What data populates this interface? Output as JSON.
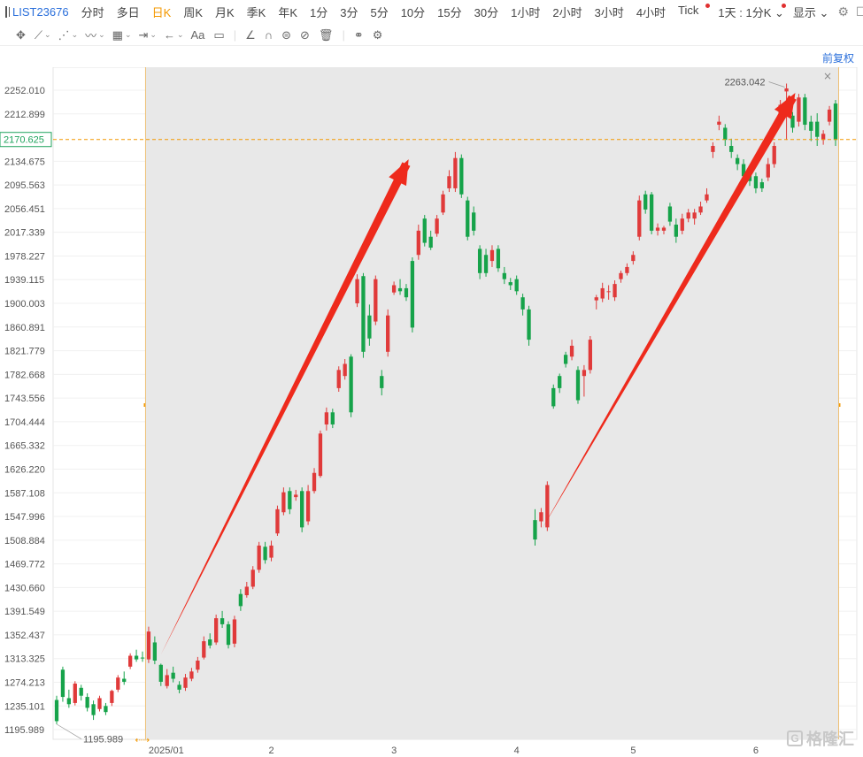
{
  "toolbar": {
    "symbol": "LIST23676",
    "periods": [
      "分时",
      "多日",
      "日K",
      "周K",
      "月K",
      "季K",
      "年K",
      "1分",
      "3分",
      "5分",
      "10分",
      "15分",
      "30分",
      "1小时",
      "2小时",
      "3小时",
      "4小时",
      "Tick"
    ],
    "active_period": "日K",
    "multi_period": "1天 : 1分K",
    "display": "显示"
  },
  "drawing_toolbar": {
    "text_tool": "Aa"
  },
  "price_adjust": "前复权",
  "colors": {
    "up": "#e03a3a",
    "down": "#16a34a",
    "accent": "#f39800",
    "arrow": "#ee2a1c",
    "current_price": "#1fa35c",
    "highlight_bg": "#e8e8e8"
  },
  "chart_data": {
    "type": "candlestick",
    "current_price": "2170.625",
    "high_label": "2263.042",
    "low_label": "1195.989",
    "y_ticks": [
      "2252.010",
      "2212.899",
      "2134.675",
      "2095.563",
      "2056.451",
      "2017.339",
      "1978.227",
      "1939.115",
      "1900.003",
      "1860.891",
      "1821.779",
      "1782.668",
      "1743.556",
      "1704.444",
      "1665.332",
      "1626.220",
      "1587.108",
      "1547.996",
      "1508.884",
      "1469.772",
      "1430.660",
      "1391.549",
      "1352.437",
      "1313.325",
      "1274.213",
      "1235.101",
      "1195.989"
    ],
    "x_labels": [
      "2025/01",
      "2",
      "3",
      "4",
      "5",
      "6"
    ],
    "ylim": [
      1180,
      2290
    ],
    "candles": [
      [
        1245,
        1210,
        1252,
        1205
      ],
      [
        1295,
        1250,
        1300,
        1242
      ],
      [
        1248,
        1238,
        1262,
        1232
      ],
      [
        1240,
        1272,
        1276,
        1236
      ],
      [
        1265,
        1252,
        1270,
        1244
      ],
      [
        1250,
        1232,
        1256,
        1226
      ],
      [
        1238,
        1220,
        1244,
        1212
      ],
      [
        1230,
        1248,
        1252,
        1226
      ],
      [
        1235,
        1225,
        1240,
        1220
      ],
      [
        1240,
        1260,
        1262,
        1235
      ],
      [
        1262,
        1282,
        1286,
        1258
      ],
      [
        1280,
        1275,
        1292,
        1270
      ],
      [
        1300,
        1318,
        1322,
        1296
      ],
      [
        1318,
        1312,
        1328,
        1308
      ],
      [
        1315,
        1314,
        1325,
        1308
      ],
      [
        1312,
        1358,
        1366,
        1306
      ],
      [
        1340,
        1310,
        1350,
        1304
      ],
      [
        1303,
        1275,
        1305,
        1268
      ],
      [
        1268,
        1286,
        1296,
        1264
      ],
      [
        1290,
        1280,
        1300,
        1274
      ],
      [
        1270,
        1262,
        1276,
        1256
      ],
      [
        1265,
        1282,
        1288,
        1260
      ],
      [
        1280,
        1292,
        1298,
        1276
      ],
      [
        1295,
        1310,
        1316,
        1290
      ],
      [
        1315,
        1342,
        1350,
        1312
      ],
      [
        1345,
        1335,
        1355,
        1330
      ],
      [
        1340,
        1380,
        1386,
        1336
      ],
      [
        1380,
        1370,
        1392,
        1364
      ],
      [
        1370,
        1336,
        1375,
        1330
      ],
      [
        1338,
        1378,
        1384,
        1332
      ],
      [
        1420,
        1400,
        1428,
        1392
      ],
      [
        1418,
        1432,
        1440,
        1414
      ],
      [
        1432,
        1460,
        1466,
        1428
      ],
      [
        1460,
        1500,
        1506,
        1455
      ],
      [
        1498,
        1476,
        1506,
        1470
      ],
      [
        1480,
        1500,
        1508,
        1474
      ],
      [
        1520,
        1560,
        1566,
        1516
      ],
      [
        1555,
        1588,
        1596,
        1550
      ],
      [
        1590,
        1560,
        1596,
        1552
      ],
      [
        1580,
        1584,
        1592,
        1574
      ],
      [
        1590,
        1530,
        1596,
        1522
      ],
      [
        1540,
        1590,
        1600,
        1534
      ],
      [
        1590,
        1620,
        1628,
        1586
      ],
      [
        1615,
        1685,
        1690,
        1612
      ],
      [
        1700,
        1720,
        1728,
        1690
      ],
      [
        1720,
        1700,
        1726,
        1694
      ],
      [
        1760,
        1790,
        1796,
        1754
      ],
      [
        1780,
        1800,
        1808,
        1774
      ],
      [
        1812,
        1720,
        1816,
        1712
      ],
      [
        1900,
        1940,
        1948,
        1894
      ],
      [
        1945,
        1820,
        1950,
        1810
      ],
      [
        1880,
        1842,
        1898,
        1830
      ],
      [
        1870,
        1940,
        1946,
        1864
      ],
      [
        1780,
        1760,
        1790,
        1748
      ],
      [
        1820,
        1880,
        1890,
        1812
      ],
      [
        1918,
        1930,
        1936,
        1914
      ],
      [
        1925,
        1920,
        1940,
        1914
      ],
      [
        1925,
        1910,
        1932,
        1904
      ],
      [
        1970,
        1860,
        1976,
        1852
      ],
      [
        1980,
        2020,
        2030,
        1972
      ],
      [
        2040,
        2000,
        2046,
        1994
      ],
      [
        2010,
        1992,
        2020,
        1988
      ],
      [
        2015,
        2040,
        2046,
        2010
      ],
      [
        2050,
        2080,
        2086,
        2046
      ],
      [
        2090,
        2110,
        2120,
        2084
      ],
      [
        2090,
        2140,
        2150,
        2084
      ],
      [
        2140,
        2080,
        2146,
        2074
      ],
      [
        2070,
        2010,
        2076,
        2004
      ],
      [
        2050,
        2020,
        2060,
        2012
      ],
      [
        1990,
        1950,
        1996,
        1940
      ],
      [
        1980,
        1950,
        1990,
        1944
      ],
      [
        1970,
        1988,
        1996,
        1960
      ],
      [
        1990,
        1958,
        1996,
        1952
      ],
      [
        1950,
        1940,
        1960,
        1932
      ],
      [
        1935,
        1930,
        1942,
        1922
      ],
      [
        1940,
        1920,
        1946,
        1914
      ],
      [
        1910,
        1890,
        1916,
        1880
      ],
      [
        1890,
        1840,
        1896,
        1830
      ],
      [
        1542,
        1510,
        1560,
        1500
      ],
      [
        1540,
        1555,
        1562,
        1530
      ],
      [
        1530,
        1600,
        1606,
        1524
      ],
      [
        1760,
        1730,
        1766,
        1726
      ],
      [
        1780,
        1760,
        1784,
        1752
      ],
      [
        1815,
        1800,
        1820,
        1794
      ],
      [
        1812,
        1830,
        1840,
        1806
      ],
      [
        1790,
        1740,
        1796,
        1734
      ],
      [
        1780,
        1790,
        1798,
        1746
      ],
      [
        1790,
        1840,
        1846,
        1784
      ],
      [
        1905,
        1910,
        1914,
        1890
      ],
      [
        1908,
        1925,
        1934,
        1902
      ],
      [
        1920,
        1920,
        1930,
        1906
      ],
      [
        1910,
        1932,
        1938,
        1904
      ],
      [
        1940,
        1950,
        1954,
        1934
      ],
      [
        1950,
        1960,
        1966,
        1946
      ],
      [
        1970,
        1980,
        1986,
        1964
      ],
      [
        2010,
        2070,
        2078,
        2004
      ],
      [
        2080,
        2055,
        2086,
        2048
      ],
      [
        2080,
        2020,
        2084,
        2014
      ],
      [
        2020,
        2025,
        2032,
        2012
      ],
      [
        2020,
        2025,
        2028,
        2014
      ],
      [
        2060,
        2035,
        2066,
        2028
      ],
      [
        2030,
        2010,
        2040,
        2000
      ],
      [
        2020,
        2040,
        2048,
        2014
      ],
      [
        2040,
        2050,
        2056,
        2034
      ],
      [
        2040,
        2050,
        2056,
        2030
      ],
      [
        2050,
        2060,
        2068,
        2046
      ],
      [
        2070,
        2080,
        2090,
        2066
      ],
      [
        2150,
        2160,
        2166,
        2140
      ],
      [
        2195,
        2200,
        2210,
        2186
      ],
      [
        2190,
        2170,
        2196,
        2160
      ],
      [
        2160,
        2150,
        2172,
        2140
      ],
      [
        2140,
        2130,
        2146,
        2120
      ],
      [
        2130,
        2110,
        2138,
        2100
      ],
      [
        2120,
        2102,
        2126,
        2094
      ],
      [
        2110,
        2090,
        2116,
        2082
      ],
      [
        2100,
        2090,
        2106,
        2084
      ],
      [
        2108,
        2130,
        2140,
        2102
      ],
      [
        2130,
        2160,
        2166,
        2124
      ],
      [
        2200,
        2228,
        2236,
        2196
      ],
      [
        2250,
        2255,
        2263,
        2170
      ],
      [
        2210,
        2190,
        2216,
        2182
      ],
      [
        2200,
        2240,
        2246,
        2192
      ],
      [
        2240,
        2195,
        2246,
        2186
      ],
      [
        2200,
        2185,
        2210,
        2168
      ],
      [
        2200,
        2175,
        2214,
        2160
      ],
      [
        2170,
        2180,
        2186,
        2162
      ],
      [
        2200,
        2220,
        2226,
        2194
      ],
      [
        2230,
        2170,
        2236,
        2160
      ]
    ]
  }
}
